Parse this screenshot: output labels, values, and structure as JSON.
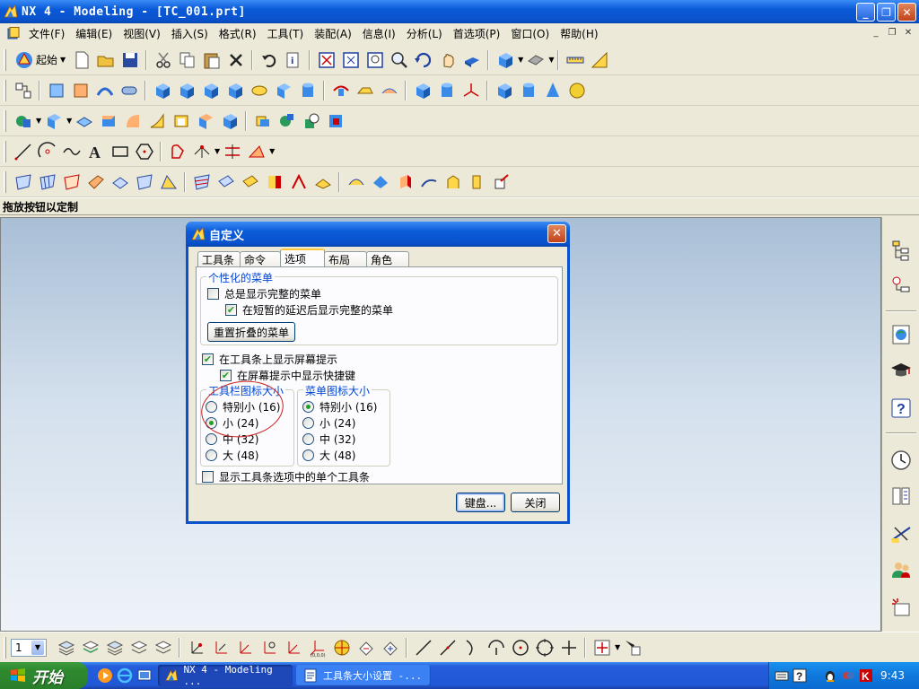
{
  "window": {
    "title": "NX 4 - Modeling - [TC_001.prt]",
    "controls": {
      "minimize": "_",
      "maximize": "❐",
      "close": "✕"
    }
  },
  "menubar": {
    "items": [
      "文件(F)",
      "编辑(E)",
      "视图(V)",
      "插入(S)",
      "格式(R)",
      "工具(T)",
      "装配(A)",
      "信息(I)",
      "分析(L)",
      "首选项(P)",
      "窗口(O)",
      "帮助(H)"
    ],
    "mdi_controls": {
      "minimize": "_",
      "restore": "❐",
      "close": "✕"
    }
  },
  "toolbar": {
    "start_label": "起始"
  },
  "status": {
    "text": "拖放按钮以定制"
  },
  "dialog": {
    "title": "自定义",
    "tabs": [
      "工具条",
      "命令",
      "选项",
      "布局",
      "角色"
    ],
    "active_tab": "选项",
    "personalized_menu": {
      "label": "个性化的菜单",
      "always_full": {
        "label": "总是显示完整的菜单",
        "checked": false
      },
      "delay_full": {
        "label": "在短暂的延迟后显示完整的菜单",
        "checked": true
      },
      "reset_button": "重置折叠的菜单"
    },
    "show_tips": {
      "label": "在工具条上显示屏幕提示",
      "checked": true
    },
    "show_shortcuts": {
      "label": "在屏幕提示中显示快捷键",
      "checked": true
    },
    "toolbar_icon_size": {
      "label": "工具栏图标大小",
      "options": [
        "特别小 (16)",
        "小 (24)",
        "中 (32)",
        "大 (48)"
      ],
      "selected_index": 1
    },
    "menu_icon_size": {
      "label": "菜单图标大小",
      "options": [
        "特别小 (16)",
        "小 (24)",
        "中 (32)",
        "大 (48)"
      ],
      "selected_index": 0
    },
    "single_toolbar": {
      "label": "显示工具条选项中的单个工具条",
      "checked": false
    },
    "keyboard_button": "键盘...",
    "close_button": "关闭"
  },
  "bottom_toolbar": {
    "layer_value": "1"
  },
  "taskbar": {
    "start_label": "开始",
    "tasks": [
      {
        "label": "NX 4 - Modeling ...",
        "active": true
      },
      {
        "label": "工具条大小设置 -...",
        "active": false
      }
    ],
    "clock": "9:43"
  },
  "colors": {
    "title_blue": "#0a52cc",
    "taskbar_blue": "#245edc",
    "start_green": "#2f8a2f",
    "check_green": "#21a121",
    "annotation_red": "#c81e1e",
    "group_label_blue": "#0046d5"
  }
}
